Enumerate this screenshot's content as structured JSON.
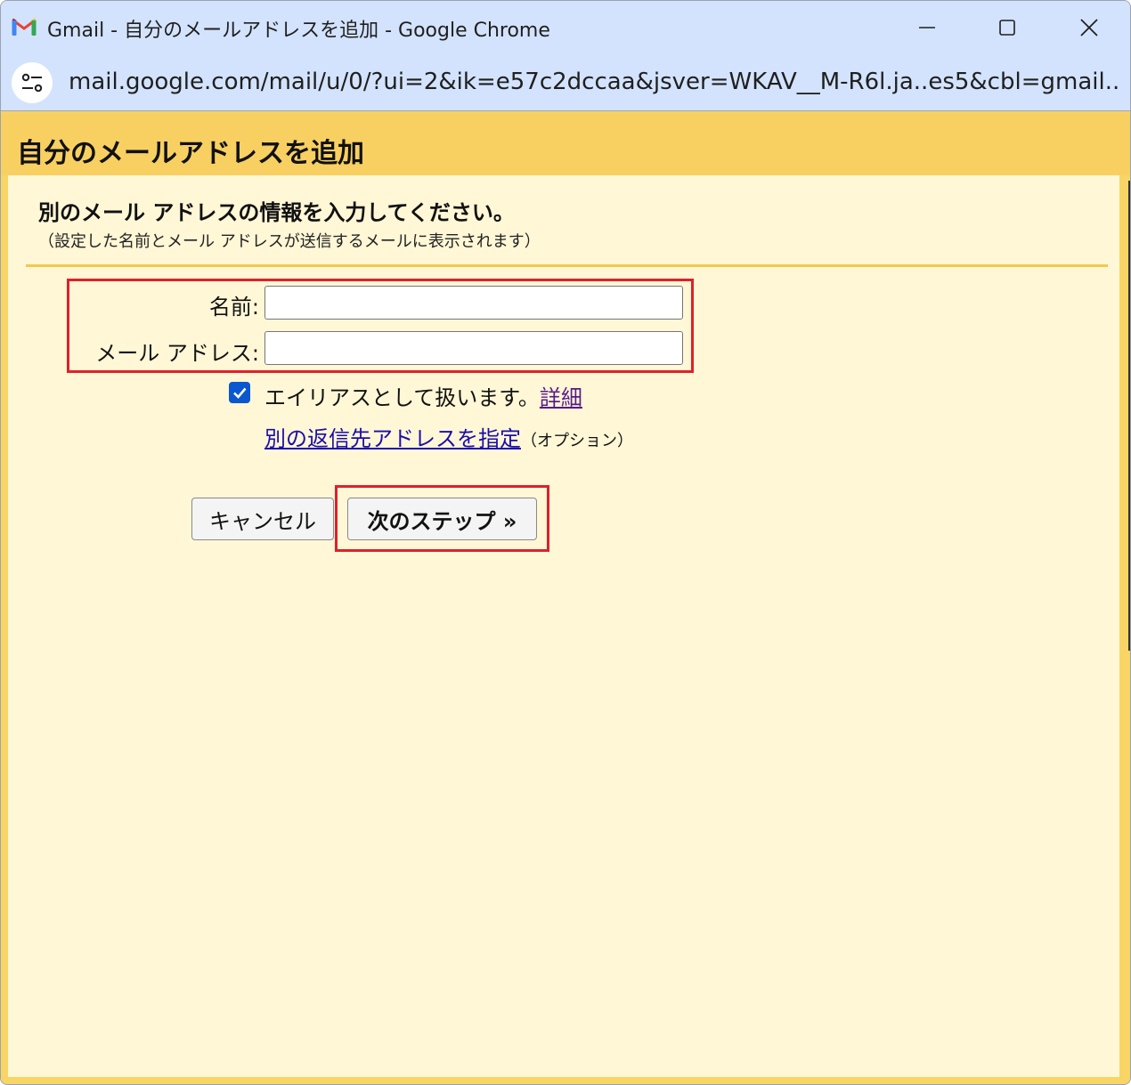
{
  "window": {
    "title": "Gmail - 自分のメールアドレスを追加 - Google Chrome",
    "url": "mail.google.com/mail/u/0/?ui=2&ik=e57c2dccaa&jsver=WKAV__M-R6l.ja..es5&cbl=gmail...."
  },
  "page": {
    "title": "自分のメールアドレスを追加",
    "heading": "別のメール アドレスの情報を入力してください。",
    "subheading": "（設定した名前とメール アドレスが送信するメールに表示されます）"
  },
  "form": {
    "name_label": "名前:",
    "name_value": "",
    "email_label": "メール アドレス:",
    "email_value": "",
    "alias_checked": true,
    "alias_text": "エイリアスとして扱います。",
    "alias_link": "詳細",
    "reply_link": "別の返信先アドレスを指定",
    "reply_option": "（オプション）"
  },
  "buttons": {
    "cancel": "キャンセル",
    "next": "次のステップ »"
  },
  "colors": {
    "header_bg": "#f8d062",
    "content_bg": "#fff7d6",
    "highlight": "#e0202a",
    "checkbox": "#0b57d0"
  }
}
